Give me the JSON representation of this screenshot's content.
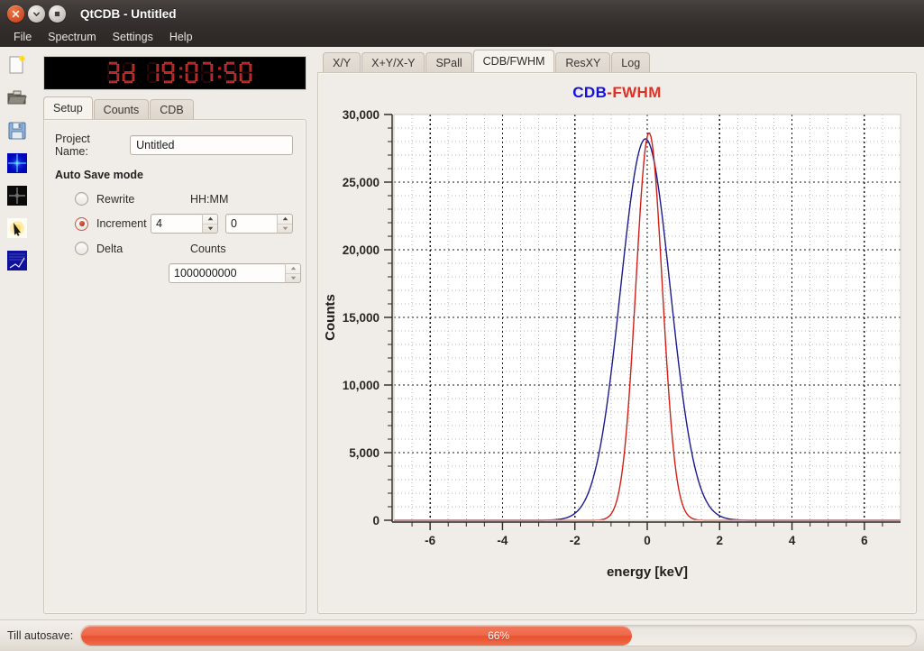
{
  "window": {
    "title": "QtCDB - Untitled",
    "buttons": [
      {
        "name": "close",
        "icon": "close-icon"
      },
      {
        "name": "minimize",
        "icon": "chevron-down-icon"
      },
      {
        "name": "maximize",
        "icon": "square-icon"
      }
    ]
  },
  "menubar": {
    "items": [
      "File",
      "Spectrum",
      "Settings",
      "Help"
    ]
  },
  "toolbar": {
    "items": [
      {
        "name": "new-document-icon",
        "tip": "New"
      },
      {
        "name": "open-folder-icon",
        "tip": "Open"
      },
      {
        "name": "save-floppy-icon",
        "tip": "Save"
      },
      {
        "name": "spectrum-blue-icon",
        "tip": "Spectrum Blue"
      },
      {
        "name": "spectrum-black-icon",
        "tip": "Spectrum Black"
      },
      {
        "name": "cursor-pick-icon",
        "tip": "Pick"
      },
      {
        "name": "plot-blue-icon",
        "tip": "Plot"
      }
    ]
  },
  "lcd": {
    "value": "3d 19:07:50",
    "days": "3d",
    "time": "19:07:50"
  },
  "left_panel": {
    "tabs": [
      {
        "label": "Setup",
        "active": true
      },
      {
        "label": "Counts",
        "active": false
      },
      {
        "label": "CDB",
        "active": false
      }
    ],
    "project_name": {
      "label": "Project Name:",
      "value": "Untitled",
      "placeholder": "Project Name"
    },
    "autosave": {
      "group_label": "Auto Save mode",
      "hhmm_label": "HH:MM",
      "counts_label": "Counts",
      "options": [
        {
          "label": "Rewrite",
          "selected": false
        },
        {
          "label": "Increment",
          "selected": true
        },
        {
          "label": "Delta",
          "selected": false
        }
      ],
      "hours_value": "4",
      "minutes_value": "0",
      "counts_value": "1000000000"
    }
  },
  "right_panel": {
    "tabs": [
      {
        "label": "X/Y",
        "active": false
      },
      {
        "label": "X+Y/X-Y",
        "active": false
      },
      {
        "label": "SPall",
        "active": false
      },
      {
        "label": "CDB/FWHM",
        "active": true
      },
      {
        "label": "ResXY",
        "active": false
      },
      {
        "label": "Log",
        "active": false
      }
    ]
  },
  "statusbar": {
    "label": "Till autosave:",
    "progress_text": "66%",
    "progress_percent": 66,
    "progress_color": "#ee6a4a"
  },
  "chart_data": {
    "type": "line",
    "title_parts": [
      {
        "text": "CDB",
        "color": "#1313d8"
      },
      {
        "text": "-",
        "color": "#cf2017"
      },
      {
        "text": "FWHM",
        "color": "#e03025"
      }
    ],
    "title": "CDB-FWHM",
    "xlabel": "energy [keV]",
    "ylabel": "Counts",
    "xlim": [
      -7.0,
      7.0
    ],
    "ylim": [
      0,
      30000
    ],
    "xticks": [
      -6,
      -4,
      -2,
      0,
      2,
      4,
      6
    ],
    "xticklabels": [
      "-6",
      "-4",
      "-2",
      "0",
      "2",
      "4",
      "6"
    ],
    "yticks": [
      0,
      5000,
      10000,
      15000,
      20000,
      25000,
      30000
    ],
    "yticklabels": [
      "0",
      "5,000",
      "10,000",
      "15,000",
      "20,000",
      "25,000",
      "30,000"
    ],
    "minor_x_per_major": 4,
    "minor_y_per_major": 5,
    "grid": true,
    "grid_major_color": "#1a1a1a",
    "grid_minor_color": "#b4b4b4",
    "legend": "none",
    "series": [
      {
        "name": "CDB",
        "color": "#1a1a8c",
        "peak_x": -0.05,
        "peak_y": 28200,
        "fwhm": 1.62,
        "shape": "gaussian"
      },
      {
        "name": "FWHM",
        "color": "#cf2017",
        "peak_x": 0.05,
        "peak_y": 28650,
        "fwhm": 0.86,
        "shape": "gaussian"
      }
    ],
    "notes": "Two overlaid near-Gaussian peaks centred at 0 keV; red (FWHM) narrower and slightly taller, blue (CDB) broader."
  }
}
